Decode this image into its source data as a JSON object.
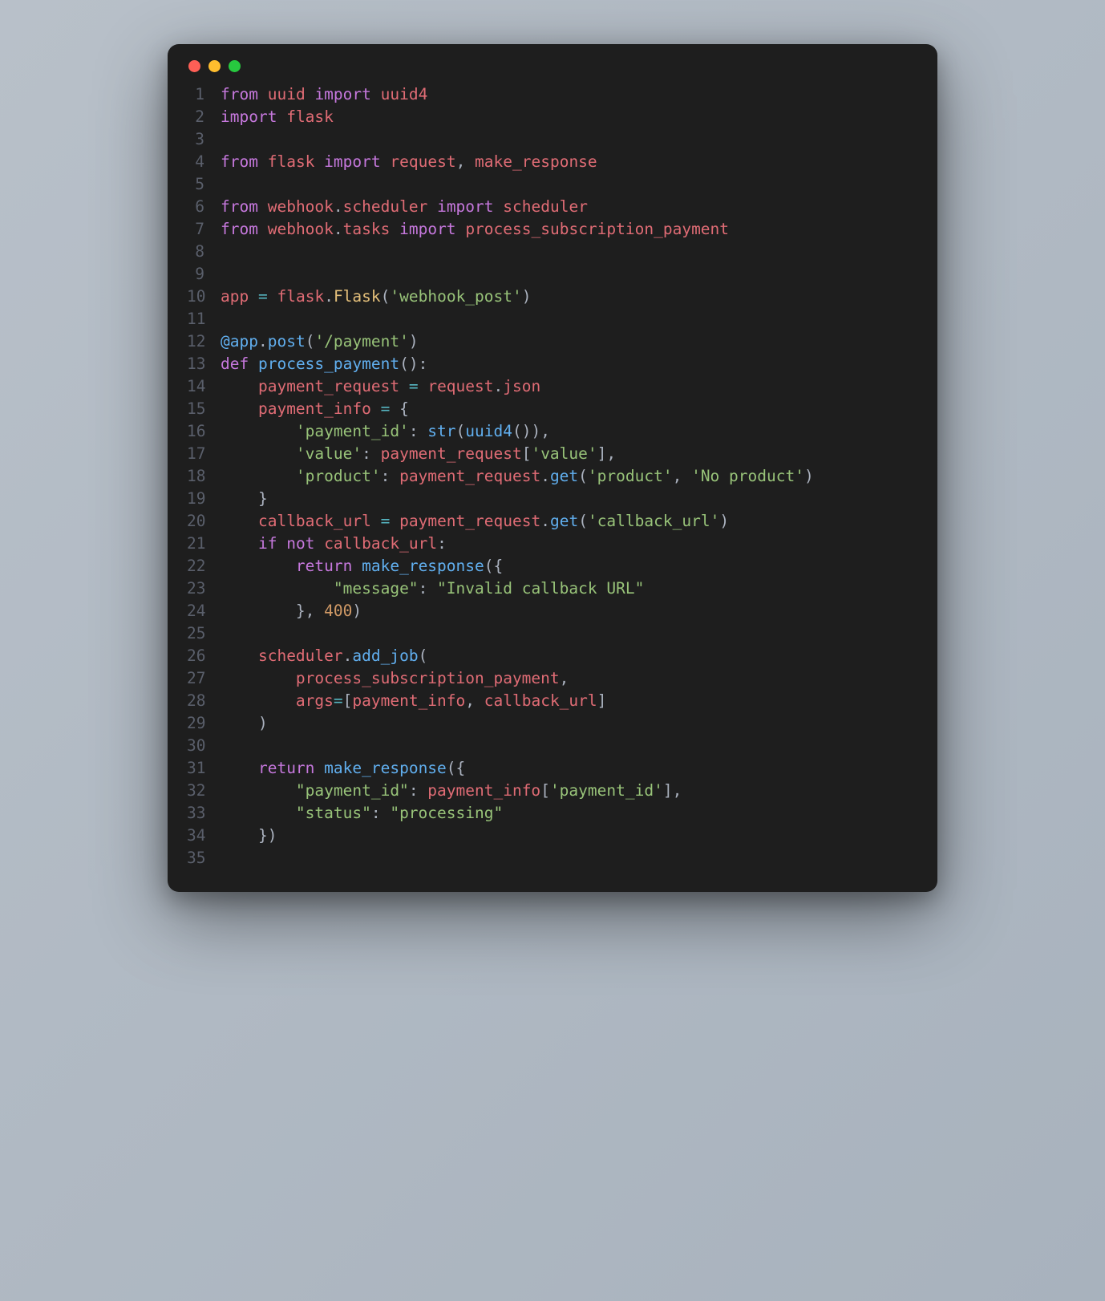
{
  "window": {
    "traffic_lights": [
      "red",
      "yellow",
      "green"
    ]
  },
  "code": {
    "line_count": 35,
    "tokens": [
      [
        {
          "c": "kw",
          "t": "from"
        },
        {
          "c": "pn",
          "t": " "
        },
        {
          "c": "var",
          "t": "uuid"
        },
        {
          "c": "pn",
          "t": " "
        },
        {
          "c": "kw",
          "t": "import"
        },
        {
          "c": "pn",
          "t": " "
        },
        {
          "c": "var",
          "t": "uuid4"
        }
      ],
      [
        {
          "c": "kw",
          "t": "import"
        },
        {
          "c": "pn",
          "t": " "
        },
        {
          "c": "var",
          "t": "flask"
        }
      ],
      [],
      [
        {
          "c": "kw",
          "t": "from"
        },
        {
          "c": "pn",
          "t": " "
        },
        {
          "c": "var",
          "t": "flask"
        },
        {
          "c": "pn",
          "t": " "
        },
        {
          "c": "kw",
          "t": "import"
        },
        {
          "c": "pn",
          "t": " "
        },
        {
          "c": "var",
          "t": "request"
        },
        {
          "c": "pn",
          "t": ", "
        },
        {
          "c": "var",
          "t": "make_response"
        }
      ],
      [],
      [
        {
          "c": "kw",
          "t": "from"
        },
        {
          "c": "pn",
          "t": " "
        },
        {
          "c": "var",
          "t": "webhook"
        },
        {
          "c": "pn",
          "t": "."
        },
        {
          "c": "var",
          "t": "scheduler"
        },
        {
          "c": "pn",
          "t": " "
        },
        {
          "c": "kw",
          "t": "import"
        },
        {
          "c": "pn",
          "t": " "
        },
        {
          "c": "var",
          "t": "scheduler"
        }
      ],
      [
        {
          "c": "kw",
          "t": "from"
        },
        {
          "c": "pn",
          "t": " "
        },
        {
          "c": "var",
          "t": "webhook"
        },
        {
          "c": "pn",
          "t": "."
        },
        {
          "c": "var",
          "t": "tasks"
        },
        {
          "c": "pn",
          "t": " "
        },
        {
          "c": "kw",
          "t": "import"
        },
        {
          "c": "pn",
          "t": " "
        },
        {
          "c": "var",
          "t": "process_subscription_payment"
        }
      ],
      [],
      [],
      [
        {
          "c": "var",
          "t": "app"
        },
        {
          "c": "pn",
          "t": " "
        },
        {
          "c": "op",
          "t": "="
        },
        {
          "c": "pn",
          "t": " "
        },
        {
          "c": "var",
          "t": "flask"
        },
        {
          "c": "pn",
          "t": "."
        },
        {
          "c": "cls",
          "t": "Flask"
        },
        {
          "c": "pn",
          "t": "("
        },
        {
          "c": "str",
          "t": "'webhook_post'"
        },
        {
          "c": "pn",
          "t": ")"
        }
      ],
      [],
      [
        {
          "c": "dec-at",
          "t": "@app"
        },
        {
          "c": "pn",
          "t": "."
        },
        {
          "c": "fn",
          "t": "post"
        },
        {
          "c": "pn",
          "t": "("
        },
        {
          "c": "str",
          "t": "'/payment'"
        },
        {
          "c": "pn",
          "t": ")"
        }
      ],
      [
        {
          "c": "kw",
          "t": "def"
        },
        {
          "c": "pn",
          "t": " "
        },
        {
          "c": "fn-def",
          "t": "process_payment"
        },
        {
          "c": "pn",
          "t": "():"
        }
      ],
      [
        {
          "c": "pn",
          "t": "    "
        },
        {
          "c": "var",
          "t": "payment_request"
        },
        {
          "c": "pn",
          "t": " "
        },
        {
          "c": "op",
          "t": "="
        },
        {
          "c": "pn",
          "t": " "
        },
        {
          "c": "var",
          "t": "request"
        },
        {
          "c": "pn",
          "t": "."
        },
        {
          "c": "var",
          "t": "json"
        }
      ],
      [
        {
          "c": "pn",
          "t": "    "
        },
        {
          "c": "var",
          "t": "payment_info"
        },
        {
          "c": "pn",
          "t": " "
        },
        {
          "c": "op",
          "t": "="
        },
        {
          "c": "pn",
          "t": " {"
        }
      ],
      [
        {
          "c": "pn",
          "t": "        "
        },
        {
          "c": "str",
          "t": "'payment_id'"
        },
        {
          "c": "pn",
          "t": ": "
        },
        {
          "c": "fn",
          "t": "str"
        },
        {
          "c": "pn",
          "t": "("
        },
        {
          "c": "fn",
          "t": "uuid4"
        },
        {
          "c": "pn",
          "t": "()),"
        }
      ],
      [
        {
          "c": "pn",
          "t": "        "
        },
        {
          "c": "str",
          "t": "'value'"
        },
        {
          "c": "pn",
          "t": ": "
        },
        {
          "c": "var",
          "t": "payment_request"
        },
        {
          "c": "pn",
          "t": "["
        },
        {
          "c": "str",
          "t": "'value'"
        },
        {
          "c": "pn",
          "t": "],"
        }
      ],
      [
        {
          "c": "pn",
          "t": "        "
        },
        {
          "c": "str",
          "t": "'product'"
        },
        {
          "c": "pn",
          "t": ": "
        },
        {
          "c": "var",
          "t": "payment_request"
        },
        {
          "c": "pn",
          "t": "."
        },
        {
          "c": "fn",
          "t": "get"
        },
        {
          "c": "pn",
          "t": "("
        },
        {
          "c": "str",
          "t": "'product'"
        },
        {
          "c": "pn",
          "t": ", "
        },
        {
          "c": "str",
          "t": "'No product'"
        },
        {
          "c": "pn",
          "t": ")"
        }
      ],
      [
        {
          "c": "pn",
          "t": "    }"
        }
      ],
      [
        {
          "c": "pn",
          "t": "    "
        },
        {
          "c": "var",
          "t": "callback_url"
        },
        {
          "c": "pn",
          "t": " "
        },
        {
          "c": "op",
          "t": "="
        },
        {
          "c": "pn",
          "t": " "
        },
        {
          "c": "var",
          "t": "payment_request"
        },
        {
          "c": "pn",
          "t": "."
        },
        {
          "c": "fn",
          "t": "get"
        },
        {
          "c": "pn",
          "t": "("
        },
        {
          "c": "str",
          "t": "'callback_url'"
        },
        {
          "c": "pn",
          "t": ")"
        }
      ],
      [
        {
          "c": "pn",
          "t": "    "
        },
        {
          "c": "kw",
          "t": "if"
        },
        {
          "c": "pn",
          "t": " "
        },
        {
          "c": "kw",
          "t": "not"
        },
        {
          "c": "pn",
          "t": " "
        },
        {
          "c": "var",
          "t": "callback_url"
        },
        {
          "c": "pn",
          "t": ":"
        }
      ],
      [
        {
          "c": "pn",
          "t": "        "
        },
        {
          "c": "kw",
          "t": "return"
        },
        {
          "c": "pn",
          "t": " "
        },
        {
          "c": "fn",
          "t": "make_response"
        },
        {
          "c": "pn",
          "t": "({"
        }
      ],
      [
        {
          "c": "pn",
          "t": "            "
        },
        {
          "c": "str",
          "t": "\"message\""
        },
        {
          "c": "pn",
          "t": ": "
        },
        {
          "c": "str",
          "t": "\"Invalid callback URL\""
        }
      ],
      [
        {
          "c": "pn",
          "t": "        }, "
        },
        {
          "c": "num",
          "t": "400"
        },
        {
          "c": "pn",
          "t": ")"
        }
      ],
      [],
      [
        {
          "c": "pn",
          "t": "    "
        },
        {
          "c": "var",
          "t": "scheduler"
        },
        {
          "c": "pn",
          "t": "."
        },
        {
          "c": "fn",
          "t": "add_job"
        },
        {
          "c": "pn",
          "t": "("
        }
      ],
      [
        {
          "c": "pn",
          "t": "        "
        },
        {
          "c": "var",
          "t": "process_subscription_payment"
        },
        {
          "c": "pn",
          "t": ","
        }
      ],
      [
        {
          "c": "pn",
          "t": "        "
        },
        {
          "c": "var",
          "t": "args"
        },
        {
          "c": "op",
          "t": "="
        },
        {
          "c": "pn",
          "t": "["
        },
        {
          "c": "var",
          "t": "payment_info"
        },
        {
          "c": "pn",
          "t": ", "
        },
        {
          "c": "var",
          "t": "callback_url"
        },
        {
          "c": "pn",
          "t": "]"
        }
      ],
      [
        {
          "c": "pn",
          "t": "    )"
        }
      ],
      [],
      [
        {
          "c": "pn",
          "t": "    "
        },
        {
          "c": "kw",
          "t": "return"
        },
        {
          "c": "pn",
          "t": " "
        },
        {
          "c": "fn",
          "t": "make_response"
        },
        {
          "c": "pn",
          "t": "({"
        }
      ],
      [
        {
          "c": "pn",
          "t": "        "
        },
        {
          "c": "str",
          "t": "\"payment_id\""
        },
        {
          "c": "pn",
          "t": ": "
        },
        {
          "c": "var",
          "t": "payment_info"
        },
        {
          "c": "pn",
          "t": "["
        },
        {
          "c": "str",
          "t": "'payment_id'"
        },
        {
          "c": "pn",
          "t": "],"
        }
      ],
      [
        {
          "c": "pn",
          "t": "        "
        },
        {
          "c": "str",
          "t": "\"status\""
        },
        {
          "c": "pn",
          "t": ": "
        },
        {
          "c": "str",
          "t": "\"processing\""
        }
      ],
      [
        {
          "c": "pn",
          "t": "    })"
        }
      ],
      []
    ]
  }
}
